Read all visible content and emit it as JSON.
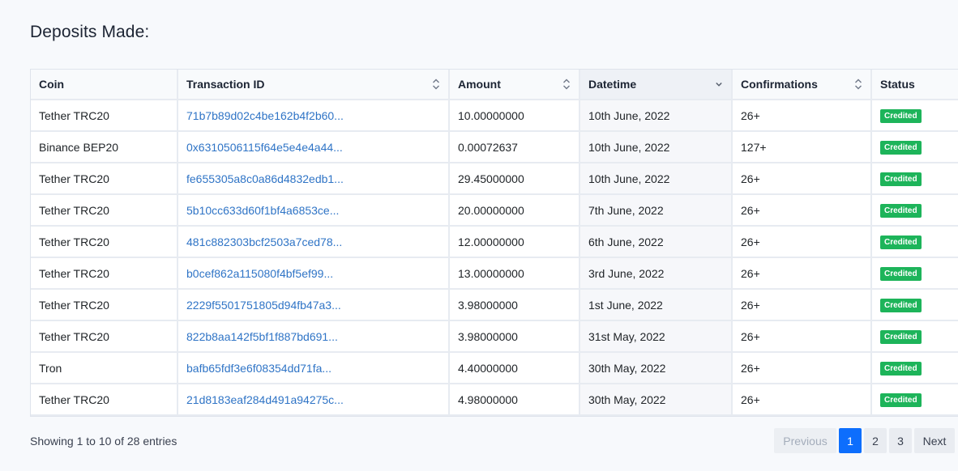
{
  "page_title": "Deposits Made:",
  "table": {
    "columns": [
      {
        "label": "Coin",
        "sortable": false
      },
      {
        "label": "Transaction ID",
        "sortable": true
      },
      {
        "label": "Amount",
        "sortable": true
      },
      {
        "label": "Datetime",
        "sortable": true,
        "sorted": "desc"
      },
      {
        "label": "Confirmations",
        "sortable": true
      },
      {
        "label": "Status",
        "sortable": false
      }
    ],
    "rows": [
      {
        "coin": "Tether TRC20",
        "txid": "71b7b89d02c4be162b4f2b60...",
        "amount": "10.00000000",
        "datetime": "10th June, 2022",
        "confirmations": "26+",
        "status": "Credited"
      },
      {
        "coin": "Binance BEP20",
        "txid": "0x6310506115f64e5e4e4a44...",
        "amount": "0.00072637",
        "datetime": "10th June, 2022",
        "confirmations": "127+",
        "status": "Credited"
      },
      {
        "coin": "Tether TRC20",
        "txid": "fe655305a8c0a86d4832edb1...",
        "amount": "29.45000000",
        "datetime": "10th June, 2022",
        "confirmations": "26+",
        "status": "Credited"
      },
      {
        "coin": "Tether TRC20",
        "txid": "5b10cc633d60f1bf4a6853ce...",
        "amount": "20.00000000",
        "datetime": "7th June, 2022",
        "confirmations": "26+",
        "status": "Credited"
      },
      {
        "coin": "Tether TRC20",
        "txid": "481c882303bcf2503a7ced78...",
        "amount": "12.00000000",
        "datetime": "6th June, 2022",
        "confirmations": "26+",
        "status": "Credited"
      },
      {
        "coin": "Tether TRC20",
        "txid": "b0cef862a115080f4bf5ef99...",
        "amount": "13.00000000",
        "datetime": "3rd June, 2022",
        "confirmations": "26+",
        "status": "Credited"
      },
      {
        "coin": "Tether TRC20",
        "txid": "2229f5501751805d94fb47a3...",
        "amount": "3.98000000",
        "datetime": "1st June, 2022",
        "confirmations": "26+",
        "status": "Credited"
      },
      {
        "coin": "Tether TRC20",
        "txid": "822b8aa142f5bf1f887bd691...",
        "amount": "3.98000000",
        "datetime": "31st May, 2022",
        "confirmations": "26+",
        "status": "Credited"
      },
      {
        "coin": "Tron",
        "txid": "bafb65fdf3e6f08354dd71fa...",
        "amount": "4.40000000",
        "datetime": "30th May, 2022",
        "confirmations": "26+",
        "status": "Credited"
      },
      {
        "coin": "Tether TRC20",
        "txid": "21d8183eaf284d491a94275c...",
        "amount": "4.98000000",
        "datetime": "30th May, 2022",
        "confirmations": "26+",
        "status": "Credited"
      }
    ]
  },
  "footer": {
    "info": "Showing 1 to 10 of 28 entries"
  },
  "pagination": {
    "previous_label": "Previous",
    "pages": [
      "1",
      "2",
      "3"
    ],
    "active_page": "1",
    "next_label": "Next"
  },
  "colors": {
    "link": "#2f74c6",
    "badge_success": "#1db45a",
    "page_active": "#0d6efd",
    "background": "#f7f9fc"
  },
  "icons": {
    "sort": "sort-both-icon",
    "sort_active": "sort-desc-icon"
  }
}
